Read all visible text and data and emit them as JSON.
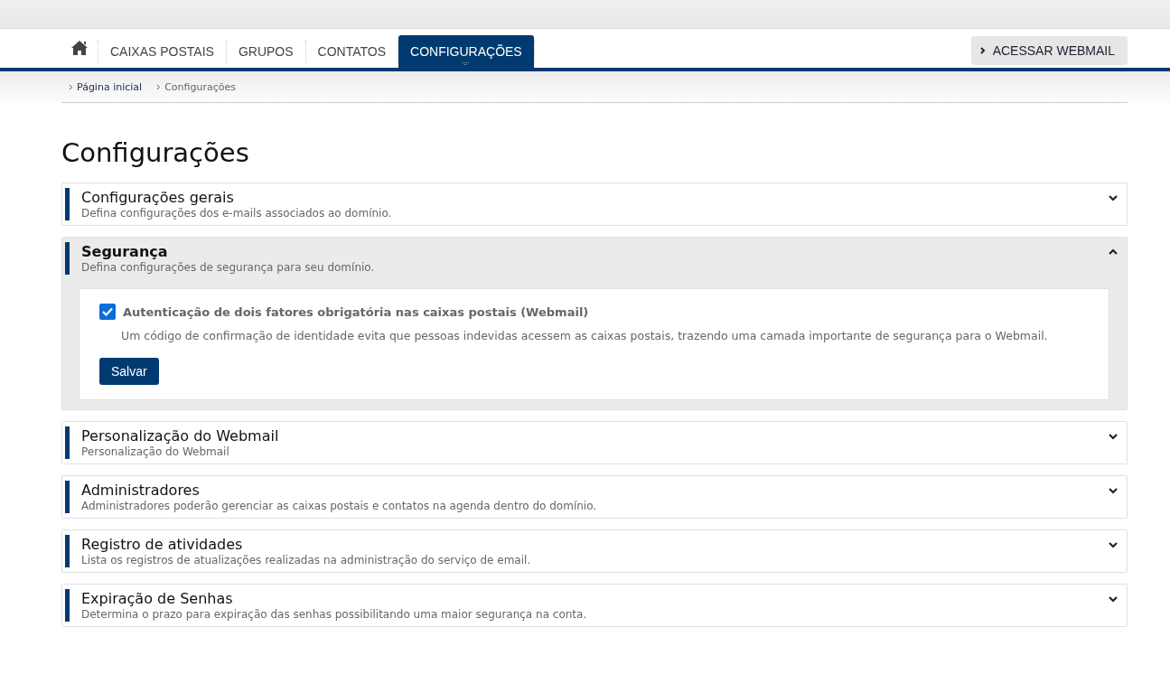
{
  "nav": {
    "tabs": [
      {
        "label": "CAIXAS POSTAIS",
        "selected": false
      },
      {
        "label": "GRUPOS",
        "selected": false
      },
      {
        "label": "CONTATOS",
        "selected": false
      },
      {
        "label": "CONFIGURAÇÕES",
        "selected": true
      }
    ],
    "webmail_button": "ACESSAR WEBMAIL"
  },
  "breadcrumb": [
    {
      "label": "Página inicial",
      "kind": "link"
    },
    {
      "label": "Configurações",
      "kind": "current"
    }
  ],
  "title": "Configurações",
  "sections": [
    {
      "title": "Configurações gerais",
      "description": "Defina configurações dos e-mails associados ao domínio.",
      "expanded": false
    },
    {
      "title": "Segurança",
      "description": "Defina configurações de segurança para seu domínio.",
      "expanded": true,
      "content": {
        "checkbox": {
          "label": "Autenticação de dois fatores obrigatória nas caixas postais (Webmail)",
          "checked": true
        },
        "help": "Um código de confirmação de identidade evita que pessoas indevidas acessem as caixas postais, trazendo uma camada importante de segurança para o Webmail.",
        "save_button": "Salvar"
      }
    },
    {
      "title": "Personalização do Webmail",
      "description": "Personalização do Webmail",
      "expanded": false
    },
    {
      "title": "Administradores",
      "description": "Administradores poderão gerenciar as caixas postais e contatos na agenda dentro do domínio.",
      "expanded": false
    },
    {
      "title": "Registro de atividades",
      "description": "Lista os registros de atualizações realizadas na administração do serviço de email.",
      "expanded": false
    },
    {
      "title": "Expiração de Senhas",
      "description": "Determina o prazo para expiração das senhas possibilitando uma maior segurança na conta.",
      "expanded": false
    }
  ]
}
